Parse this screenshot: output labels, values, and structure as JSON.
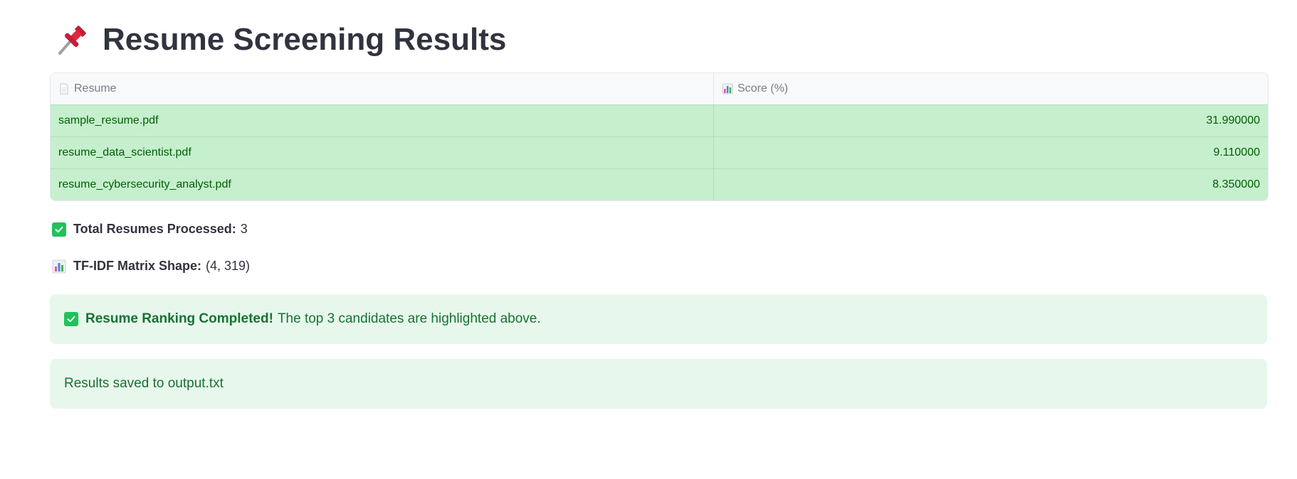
{
  "header": {
    "title": "Resume Screening Results",
    "title_icon": "pushpin-icon"
  },
  "table": {
    "columns": [
      {
        "label": "Resume",
        "icon": "document-icon"
      },
      {
        "label": "Score (%)",
        "icon": "bar-chart-icon"
      }
    ],
    "rows": [
      {
        "resume": "sample_resume.pdf",
        "score": "31.990000"
      },
      {
        "resume": "resume_data_scientist.pdf",
        "score": "9.110000"
      },
      {
        "resume": "resume_cybersecurity_analyst.pdf",
        "score": "8.350000"
      }
    ],
    "highlight_color": "#c6efce",
    "highlight_text_color": "#006100"
  },
  "stats": {
    "total_label": "Total Resumes Processed:",
    "total_value": "3",
    "matrix_label": "TF-IDF Matrix Shape:",
    "matrix_value": "(4, 319)"
  },
  "alerts": {
    "ranking_bold": "Resume Ranking Completed!",
    "ranking_text": "The top 3 candidates are highlighted above.",
    "saved_text": "Results saved to output.txt",
    "success_bg": "#e7f7ec",
    "success_text": "#177233"
  }
}
